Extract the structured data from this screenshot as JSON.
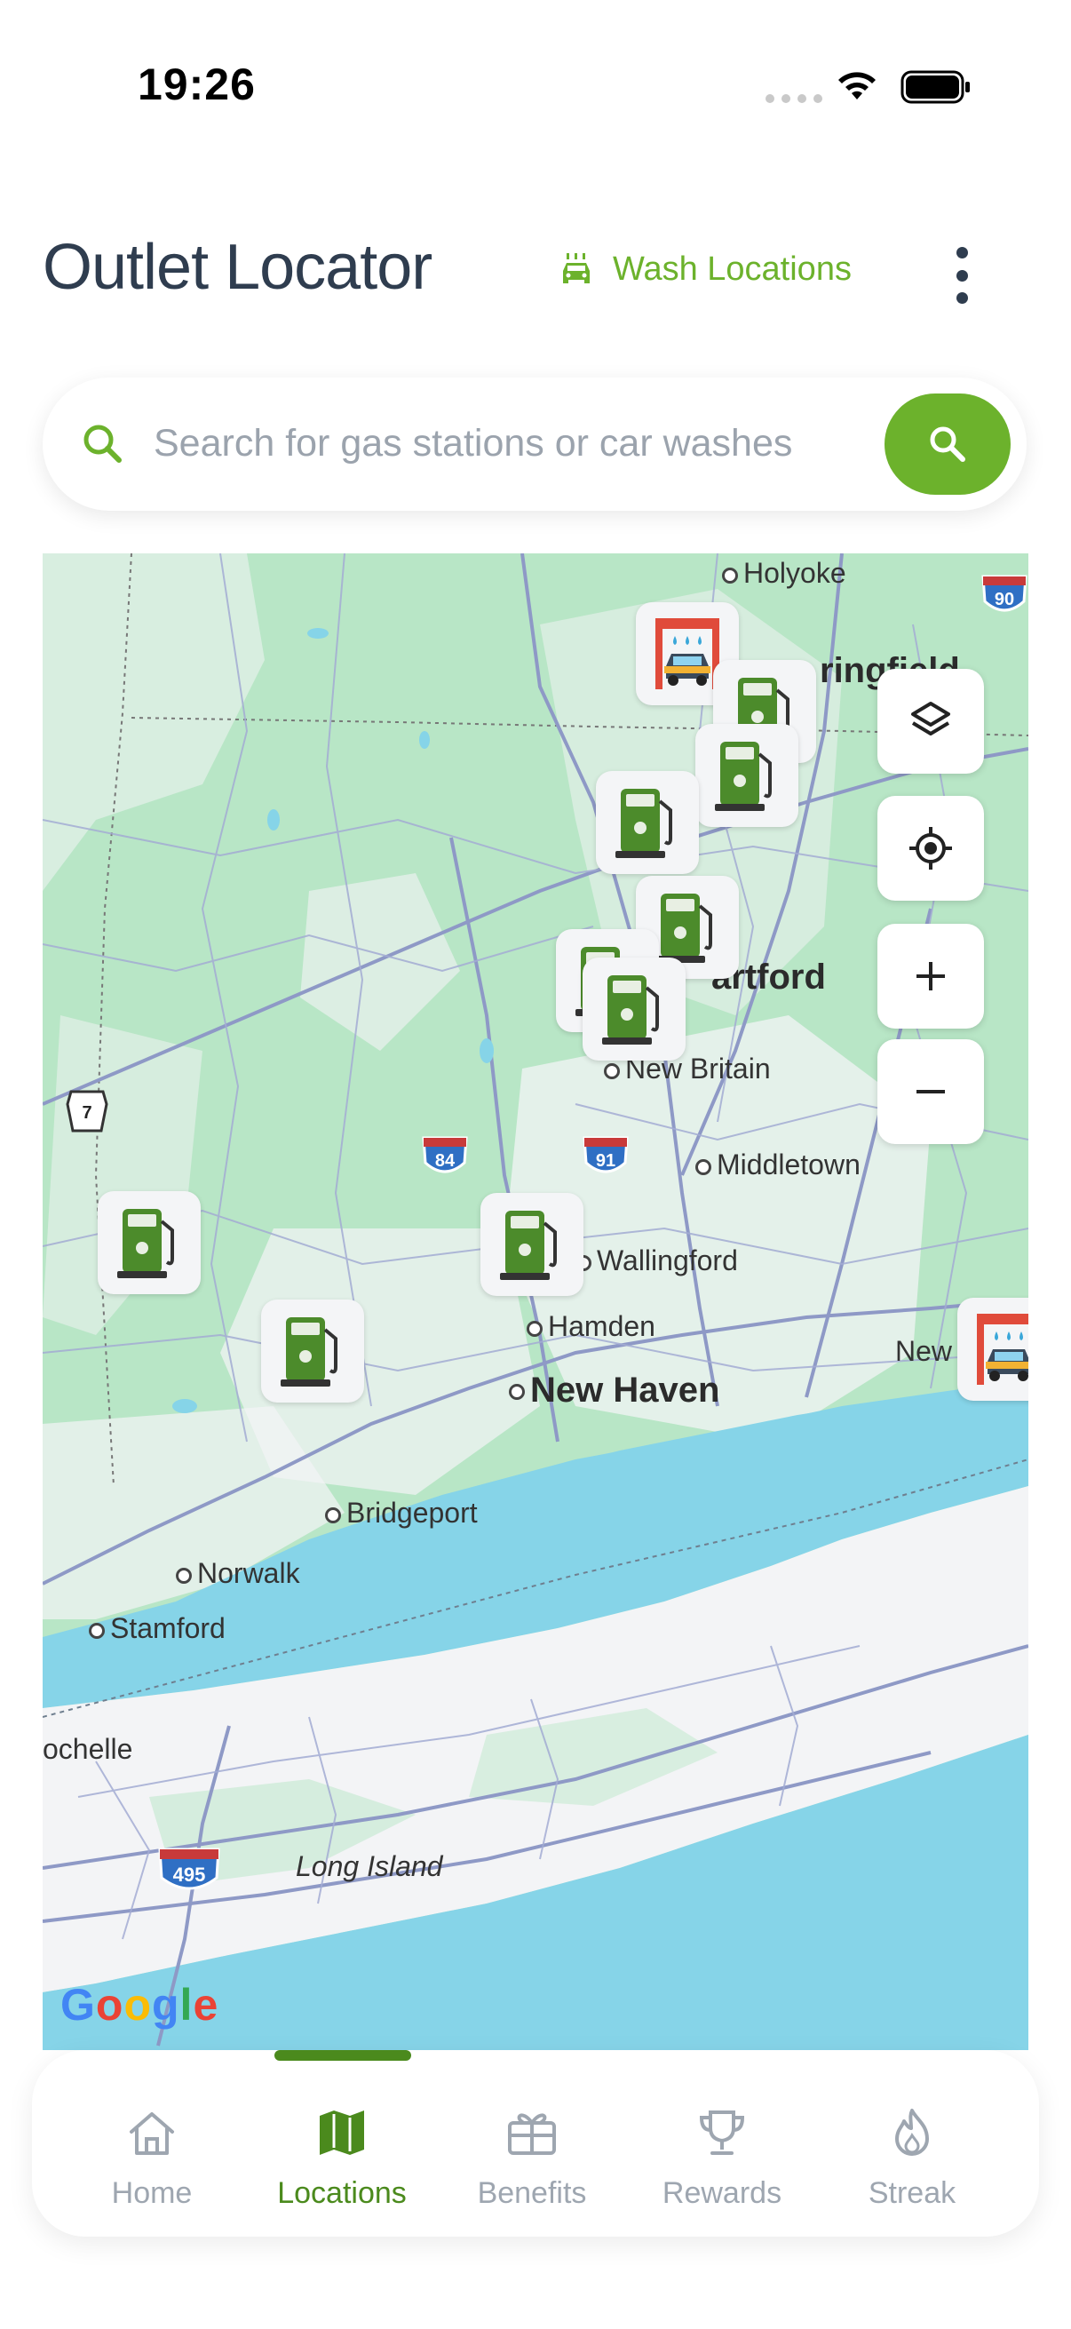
{
  "status_bar": {
    "time": "19:26"
  },
  "header": {
    "title": "Outlet Locator",
    "wash_link_label": "Wash Locations"
  },
  "search": {
    "placeholder": "Search for gas stations or car washes"
  },
  "map": {
    "labels": {
      "holyoke": "Holyoke",
      "springfield": "ringfield",
      "hartford": "artford",
      "new_britain": "New Britain",
      "middletown": "Middletown",
      "wallingford": "Wallingford",
      "hamden": "Hamden",
      "new_haven": "New Haven",
      "new_london": "New Lond",
      "bridgeport": "Bridgeport",
      "norwalk": "Norwalk",
      "stamford": "Stamford",
      "new_rochelle": "ochelle",
      "long_island": "Long Island"
    },
    "shields": {
      "i90": "90",
      "us7": "7",
      "i84": "84",
      "i91": "91",
      "i495": "495"
    },
    "attribution": "Google",
    "colors": {
      "land": "#b8e6c6",
      "water": "#86d4e8",
      "road": "#8e99c6",
      "urban": "#f3f4f6"
    }
  },
  "tabs": [
    {
      "label": "Home",
      "icon": "home-icon",
      "active": false
    },
    {
      "label": "Locations",
      "icon": "map-icon",
      "active": true
    },
    {
      "label": "Benefits",
      "icon": "gift-icon",
      "active": false
    },
    {
      "label": "Rewards",
      "icon": "trophy-icon",
      "active": false
    },
    {
      "label": "Streak",
      "icon": "flame-icon",
      "active": false
    }
  ],
  "colors": {
    "accent": "#6cb22c",
    "accent_dark": "#4b8a1d",
    "title": "#2f3d4f",
    "muted": "#9ea6b0"
  }
}
